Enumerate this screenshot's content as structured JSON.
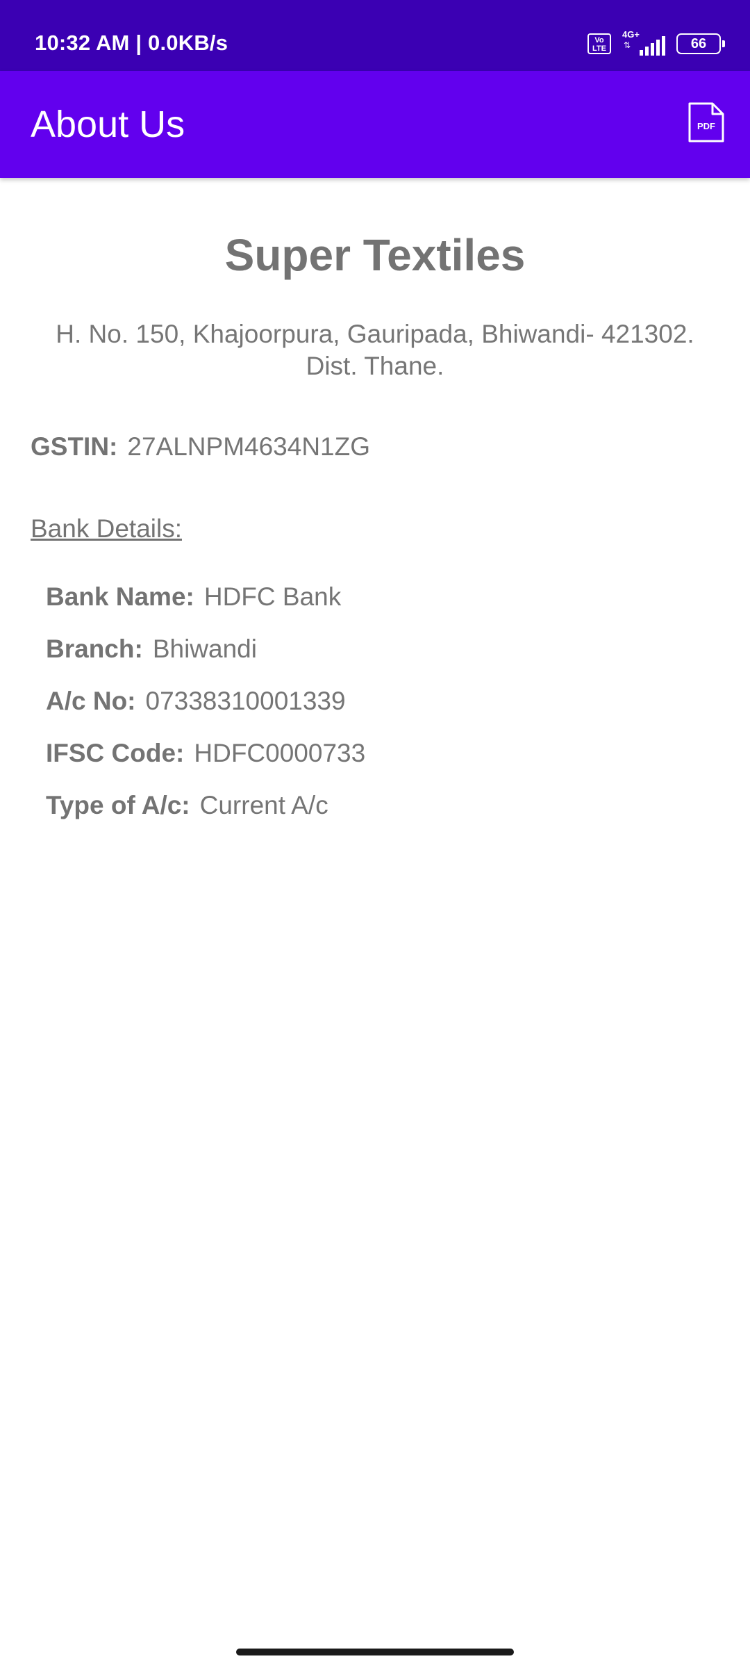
{
  "status_bar": {
    "time": "10:32 AM | 0.0KB/s",
    "volte_label": "Vo LTE",
    "network": "4G+",
    "network_arrows": "⇅",
    "battery": "66"
  },
  "app_bar": {
    "title": "About Us",
    "pdf_icon_label": "PDF",
    "background_color": "#6200ee",
    "status_color": "#3b00b3"
  },
  "company": {
    "name": "Super Textiles",
    "address_line1": "H. No. 150, Khajoorpura, Gauripada, Bhiwandi- 421302.",
    "address_line2": "Dist. Thane."
  },
  "gstin": {
    "label": "GSTIN:",
    "value": "27ALNPM4634N1ZG"
  },
  "bank": {
    "heading": "Bank Details:",
    "rows": [
      {
        "label": "Bank Name:",
        "value": "HDFC Bank"
      },
      {
        "label": "Branch:",
        "value": "Bhiwandi"
      },
      {
        "label": "A/c No:",
        "value": "07338310001339"
      },
      {
        "label": "IFSC Code:",
        "value": "HDFC0000733"
      },
      {
        "label": "Type of A/c:",
        "value": "Current A/c"
      }
    ]
  }
}
